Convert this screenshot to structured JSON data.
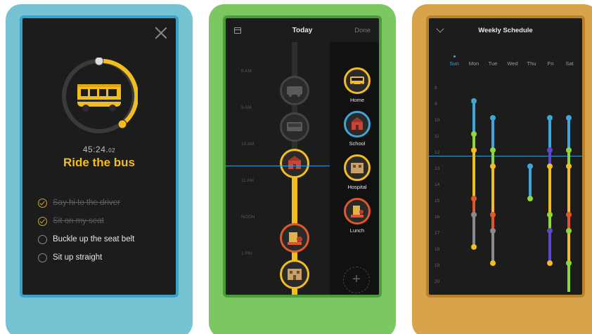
{
  "screen1": {
    "timer_main": "45:24.",
    "timer_fraction": "02",
    "task_title": "Ride the bus",
    "progress": 0.6,
    "checklist": [
      {
        "label": "Say hi to the driver",
        "done": true
      },
      {
        "label": "Sit on my seat",
        "done": true
      },
      {
        "label": "Buckle up the seat belt",
        "done": false
      },
      {
        "label": "Sit up straight",
        "done": false
      }
    ]
  },
  "screen2": {
    "title": "Today",
    "done_label": "Done",
    "time_labels": [
      "8 AM",
      "9 AM",
      "10 AM",
      "11 AM",
      "NOON",
      "1 PM"
    ],
    "places": [
      {
        "label": "Home",
        "ring_color": "#f2bd1f",
        "icon": "bus-icon"
      },
      {
        "label": "School",
        "ring_color": "#3fa7d6",
        "icon": "school-icon"
      },
      {
        "label": "Hospital",
        "ring_color": "#f2bd1f",
        "icon": "hospital-icon"
      },
      {
        "label": "Lunch",
        "ring_color": "#e0572b",
        "icon": "lunch-icon"
      }
    ],
    "add_symbol": "+"
  },
  "screen3": {
    "title": "Weekly Schedule",
    "days": [
      "Sun",
      "Mon",
      "Tue",
      "Wed",
      "Thu",
      "Fri",
      "Sat"
    ],
    "today": "Sun",
    "hours": [
      "8",
      "9",
      "10",
      "11",
      "12",
      "13",
      "14",
      "15",
      "16",
      "17",
      "18",
      "19",
      "20"
    ]
  },
  "colors": {
    "accent_yellow": "#f2bd1f",
    "blue": "#3fa7d6",
    "green": "#8ed63a",
    "orange": "#e0572b",
    "purple": "#5a47c9",
    "gray": "#8a8a8a"
  }
}
